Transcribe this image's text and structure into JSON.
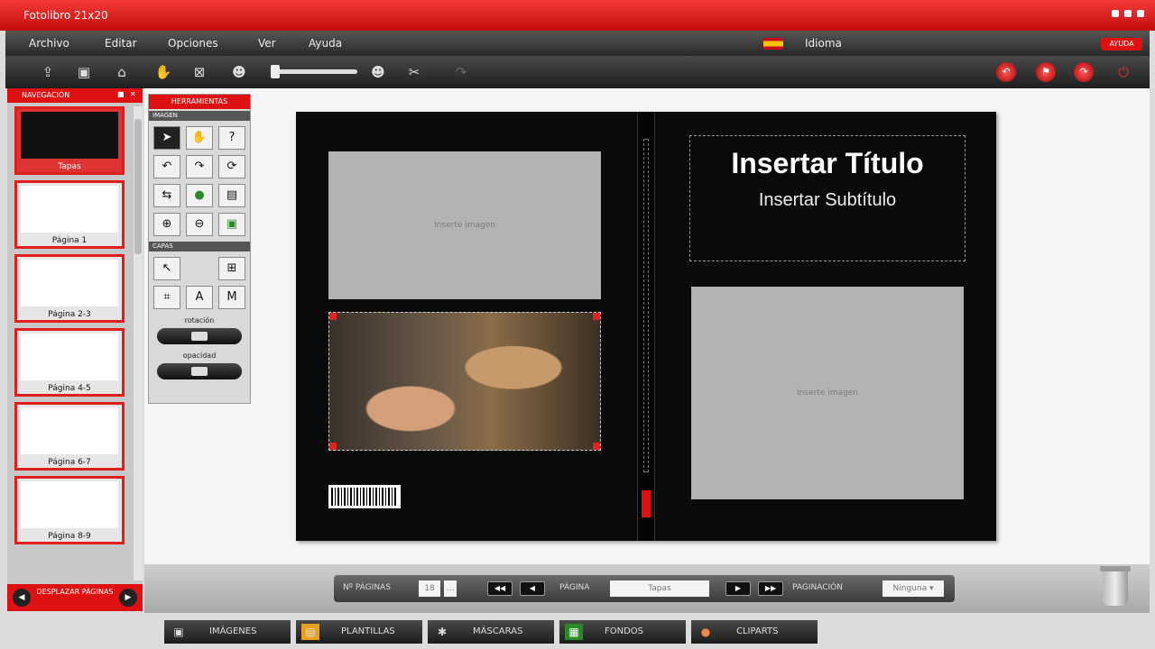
{
  "window": {
    "title": "Fotolibro 21x20"
  },
  "menu": {
    "items": [
      "Archivo",
      "Editar",
      "Opciones",
      "Ver",
      "Ayuda"
    ],
    "language": "Idioma",
    "help_badge": "AYUDA"
  },
  "toolbar": {
    "icons": [
      "export-icon",
      "folder-icon",
      "lock-icon",
      "hand-icon",
      "grid-icon",
      "zoom-out-person-icon",
      "zoom-slider",
      "zoom-in-person-icon",
      "cut-icon",
      "redo-icon"
    ],
    "right_buttons": [
      "back-red-icon",
      "flag-red-icon",
      "forward-red-icon"
    ]
  },
  "navigation": {
    "header": "NAVEGACIÓN",
    "thumbnails": [
      "Tapas",
      "Página 1",
      "Página 2-3",
      "Página 4-5",
      "Página 6-7",
      "Página 8-9"
    ],
    "footer": "DESPLAZAR PÁGINAS"
  },
  "tools": {
    "header": "HERRAMIENTAS",
    "section_images": "IMAGEN",
    "section_layers": "CAPAS",
    "rotation_label": "rotación",
    "opacity_label": "opacidad"
  },
  "canvas": {
    "title": "Insertar Título",
    "subtitle": "Insertar Subtítulo",
    "placeholder": "Inserte imagen"
  },
  "pager": {
    "pages_label": "Nº PÁGINAS",
    "pages_value": "18",
    "page_label": "PÁGINA",
    "page_value": "Tapas",
    "pagination_label": "PAGINACIÓN",
    "pagination_value": "Ninguna"
  },
  "bottom_tabs": [
    "IMÁGENES",
    "PLANTILLAS",
    "MÁSCARAS",
    "FONDOS",
    "CLIPARTS"
  ],
  "colors": {
    "accent": "#e01e1e",
    "dark": "#1e1e1e"
  }
}
